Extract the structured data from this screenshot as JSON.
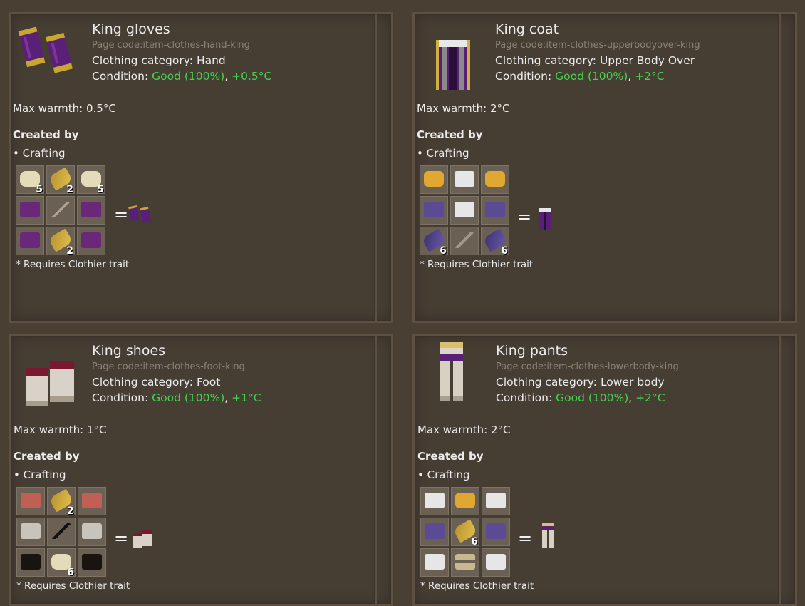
{
  "panels": [
    {
      "title": "King gloves",
      "page_code": "Page code:item-clothes-hand-king",
      "category_prefix": "Clothing category: ",
      "category": "Hand",
      "condition_prefix": "Condition: ",
      "condition_value": "Good (100%)",
      "condition_sep": ", ",
      "condition_temp": "+0.5°C",
      "max_warmth": "Max warmth: 0.5°C",
      "created_by": "Created by",
      "method": "• Crafting",
      "grid": [
        {
          "icon": "cotton-icon",
          "qty": "5"
        },
        {
          "icon": "flax-icon",
          "qty": "2"
        },
        {
          "icon": "cotton-icon",
          "qty": "5"
        },
        {
          "icon": "purple-cloth-icon",
          "qty": ""
        },
        {
          "icon": "needle-icon",
          "qty": ""
        },
        {
          "icon": "purple-cloth-icon",
          "qty": ""
        },
        {
          "icon": "purple-cloth-icon",
          "qty": ""
        },
        {
          "icon": "flax-icon",
          "qty": "2"
        },
        {
          "icon": "purple-cloth-icon",
          "qty": ""
        }
      ],
      "equals": "=",
      "result_icon": "king-gloves-icon",
      "note": "* Requires Clothier trait"
    },
    {
      "title": "King coat",
      "page_code": "Page code:item-clothes-upperbodyover-king",
      "category_prefix": "Clothing category: ",
      "category": "Upper Body Over",
      "condition_prefix": "Condition: ",
      "condition_value": "Good (100%)",
      "condition_sep": ", ",
      "condition_temp": "+2°C",
      "max_warmth": "Max warmth: 2°C",
      "created_by": "Created by",
      "method": "• Crafting",
      "grid": [
        {
          "icon": "gold-thread-icon",
          "qty": ""
        },
        {
          "icon": "white-cloth-icon",
          "qty": ""
        },
        {
          "icon": "gold-thread-icon",
          "qty": ""
        },
        {
          "icon": "violet-cloth-icon",
          "qty": ""
        },
        {
          "icon": "white-cloth-icon",
          "qty": ""
        },
        {
          "icon": "violet-cloth-icon",
          "qty": ""
        },
        {
          "icon": "violet-flax-icon",
          "qty": "6"
        },
        {
          "icon": "stick-icon",
          "qty": ""
        },
        {
          "icon": "violet-flax-icon",
          "qty": "6"
        }
      ],
      "equals": "=",
      "result_icon": "king-coat-icon",
      "note": "* Requires Clothier trait"
    },
    {
      "title": "King shoes",
      "page_code": "Page code:item-clothes-foot-king",
      "category_prefix": "Clothing category: ",
      "category": "Foot",
      "condition_prefix": "Condition: ",
      "condition_value": "Good (100%)",
      "condition_sep": ", ",
      "condition_temp": "+1°C",
      "max_warmth": "Max warmth: 1°C",
      "created_by": "Created by",
      "method": "• Crafting",
      "grid": [
        {
          "icon": "red-leather-icon",
          "qty": ""
        },
        {
          "icon": "flax-icon",
          "qty": "2"
        },
        {
          "icon": "red-leather-icon",
          "qty": ""
        },
        {
          "icon": "grey-cloth-icon",
          "qty": ""
        },
        {
          "icon": "black-needle-icon",
          "qty": ""
        },
        {
          "icon": "grey-cloth-icon",
          "qty": ""
        },
        {
          "icon": "black-leather-icon",
          "qty": ""
        },
        {
          "icon": "cotton-icon",
          "qty": "6"
        },
        {
          "icon": "black-leather-icon",
          "qty": ""
        }
      ],
      "equals": "=",
      "result_icon": "king-shoes-icon",
      "note": "* Requires Clothier trait"
    },
    {
      "title": "King pants",
      "page_code": "Page code:item-clothes-lowerbody-king",
      "category_prefix": "Clothing category: ",
      "category": "Lower body",
      "condition_prefix": "Condition: ",
      "condition_value": "Good (100%)",
      "condition_sep": ", ",
      "condition_temp": "+2°C",
      "max_warmth": "Max warmth: 2°C",
      "created_by": "Created by",
      "method": "• Crafting",
      "grid": [
        {
          "icon": "white-cloth-icon",
          "qty": ""
        },
        {
          "icon": "gold-thread-icon",
          "qty": ""
        },
        {
          "icon": "white-cloth-icon",
          "qty": ""
        },
        {
          "icon": "violet-cloth-icon",
          "qty": ""
        },
        {
          "icon": "flax-icon",
          "qty": "6"
        },
        {
          "icon": "violet-cloth-icon",
          "qty": ""
        },
        {
          "icon": "white-cloth-icon",
          "qty": ""
        },
        {
          "icon": "belt-icon",
          "qty": ""
        },
        {
          "icon": "white-cloth-icon",
          "qty": ""
        }
      ],
      "equals": "=",
      "result_icon": "king-pants-icon",
      "note": "* Requires Clothier trait"
    }
  ],
  "colors": {
    "good": "#45d24e",
    "panel_bg": "#463d33",
    "slot_bg": "#6a6154"
  }
}
